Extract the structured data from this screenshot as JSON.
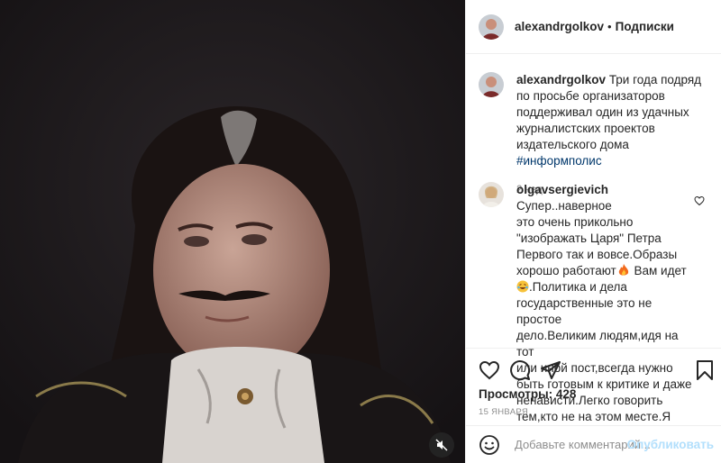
{
  "header": {
    "username": "alexandrgolkov",
    "separator": "•",
    "follow_label": "Подписки"
  },
  "caption": {
    "username": "alexandrgolkov",
    "text": "Три года подряд по просьбе организаторов поддерживал один из удачных журналистских проектов издательского дома",
    "hashtag": "#информполис",
    "time": "2 нед."
  },
  "comment": {
    "username": "olgavsergievich",
    "lines": [
      "Супер..наверное",
      "это очень прикольно",
      "\"изображать Царя\" Петра",
      "Первого так и вовсе.Образы",
      "хорошо работают",
      "Вам идет",
      ".Политика и дела",
      "государственные это не простое",
      "дело.Великим людям,идя на тот",
      "или иной пост,всегда нужно",
      "быть готовым к критике и даже",
      "ненависти.Легко говорить",
      "тем,кто не на этом месте.Я"
    ]
  },
  "actions": {
    "like_icon": "heart-icon",
    "comment_icon": "comment-bubble-icon",
    "share_icon": "paper-plane-icon",
    "save_icon": "bookmark-icon"
  },
  "views_label": "Просмотры: 428",
  "date": "15 ЯНВАРЯ",
  "add_comment": {
    "placeholder": "Добавьте комментарий...",
    "publish_label": "Опубликовать"
  },
  "colors": {
    "link": "#00376b",
    "publish_disabled": "#b2dffc",
    "muted": "#8e8e8e"
  }
}
